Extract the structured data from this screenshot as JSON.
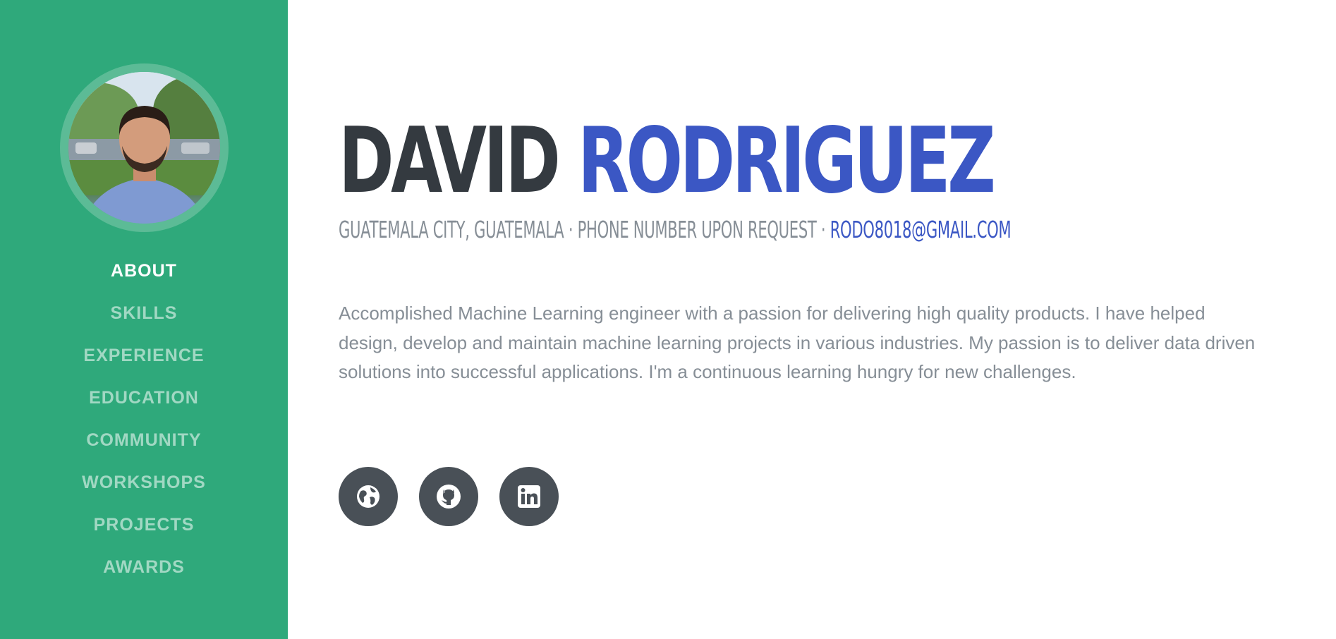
{
  "profile": {
    "first_name": "DAVID",
    "last_name": "RODRIGUEZ",
    "location": "GUATEMALA CITY, GUATEMALA",
    "phone": "PHONE NUMBER UPON REQUEST",
    "separator": " · ",
    "email": "RODO8018@GMAIL.COM",
    "summary": "Accomplished Machine Learning engineer with a passion for delivering high quality products. I have helped design, develop and maintain machine learning projects in various industries. My passion is to deliver data driven solutions into successful applications. I'm a continuous learning hungry for new challenges."
  },
  "nav": {
    "items": [
      {
        "label": "ABOUT"
      },
      {
        "label": "SKILLS"
      },
      {
        "label": "EXPERIENCE"
      },
      {
        "label": "EDUCATION"
      },
      {
        "label": "COMMUNITY"
      },
      {
        "label": "WORKSHOPS"
      },
      {
        "label": "PROJECTS"
      },
      {
        "label": "AWARDS"
      }
    ],
    "active": "ABOUT"
  },
  "social": [
    {
      "icon": "globe-icon"
    },
    {
      "icon": "github-icon"
    },
    {
      "icon": "linkedin-icon"
    }
  ],
  "colors": {
    "sidebar": "#2fa97b",
    "accent": "#3b57c4",
    "heading": "#343a40",
    "muted": "#868e96",
    "social_bg": "#495057"
  }
}
